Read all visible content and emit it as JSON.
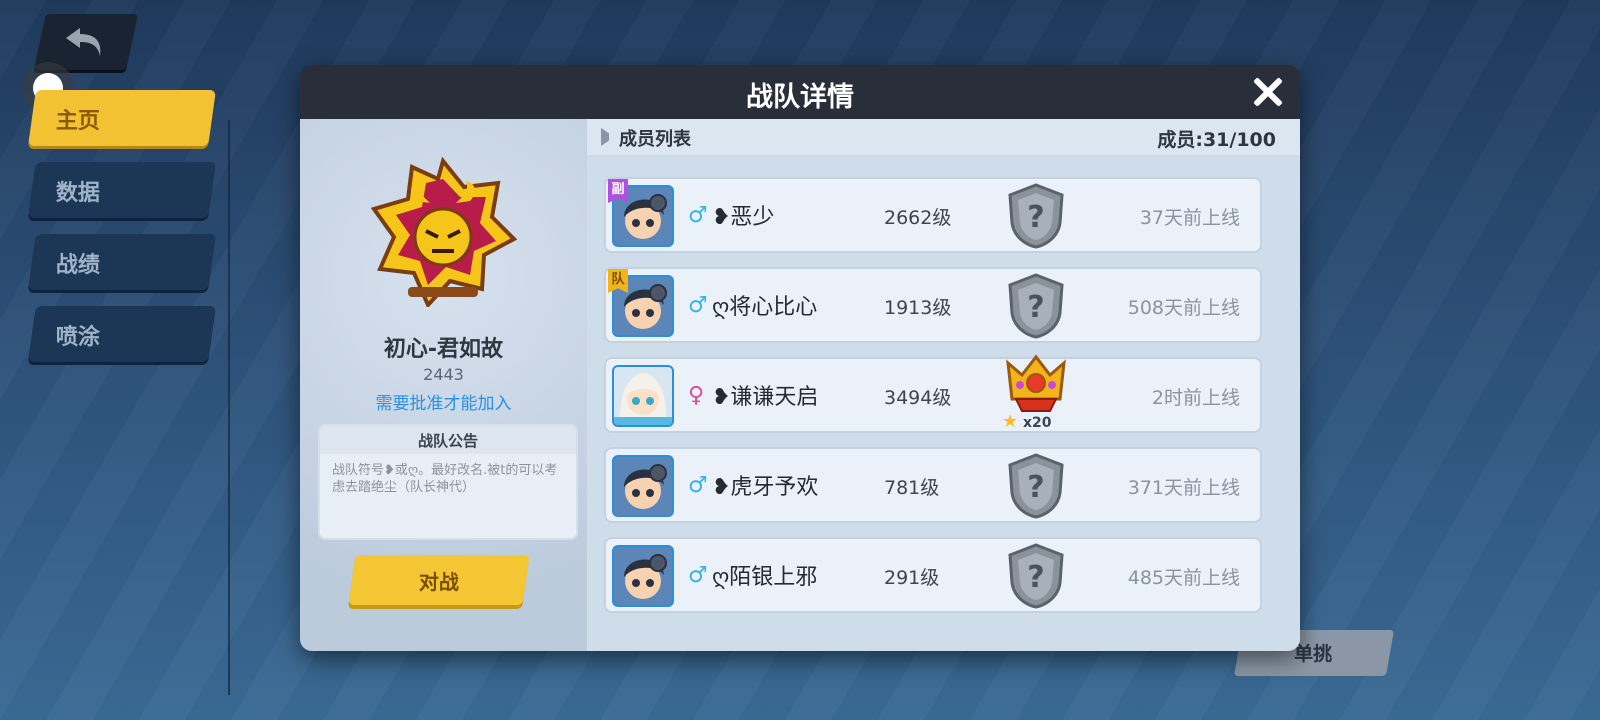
{
  "nav": {
    "items": [
      {
        "label": "主页",
        "active": true
      },
      {
        "label": "数据",
        "active": false
      },
      {
        "label": "战绩",
        "active": false
      },
      {
        "label": "喷涂",
        "active": false
      }
    ]
  },
  "duel_button": "单挑",
  "modal": {
    "title": "战队详情",
    "team": {
      "name": "初心-君如故",
      "id": "2443",
      "join_requirement": "需要批准才能加入",
      "notice_title": "战队公告",
      "notice_text": "战队符号❥或ღ。最好改名.被t的可以考虑去踏绝尘（队长神代）",
      "battle_button": "对战"
    },
    "members_list": {
      "title": "成员列表",
      "count": "成员:31/100",
      "rows": [
        {
          "role": "副",
          "gender": "♂",
          "gender_type": "male",
          "name": "❥恶少",
          "level": "2662级",
          "rank": "unknown",
          "online": "37天前上线"
        },
        {
          "role": "队",
          "gender": "♂",
          "gender_type": "male",
          "name": "ღ将心比心",
          "level": "1913级",
          "rank": "unknown",
          "online": "508天前上线"
        },
        {
          "role": "",
          "gender": "♀",
          "gender_type": "female",
          "name": "❥谦谦天启",
          "level": "3494级",
          "rank": "crown",
          "stars": "x20",
          "online": "2时前上线"
        },
        {
          "role": "",
          "gender": "♂",
          "gender_type": "male",
          "name": "❥虎牙予欢",
          "level": "781级",
          "rank": "unknown",
          "online": "371天前上线"
        },
        {
          "role": "",
          "gender": "♂",
          "gender_type": "male",
          "name": "ღ陌银上邪",
          "level": "291级",
          "rank": "unknown",
          "online": "485天前上线"
        }
      ]
    }
  },
  "colors": {
    "accent_yellow": "#f2c233",
    "link_blue": "#2a8fe0",
    "male": "#36b4e8",
    "female": "#e44a9c"
  }
}
